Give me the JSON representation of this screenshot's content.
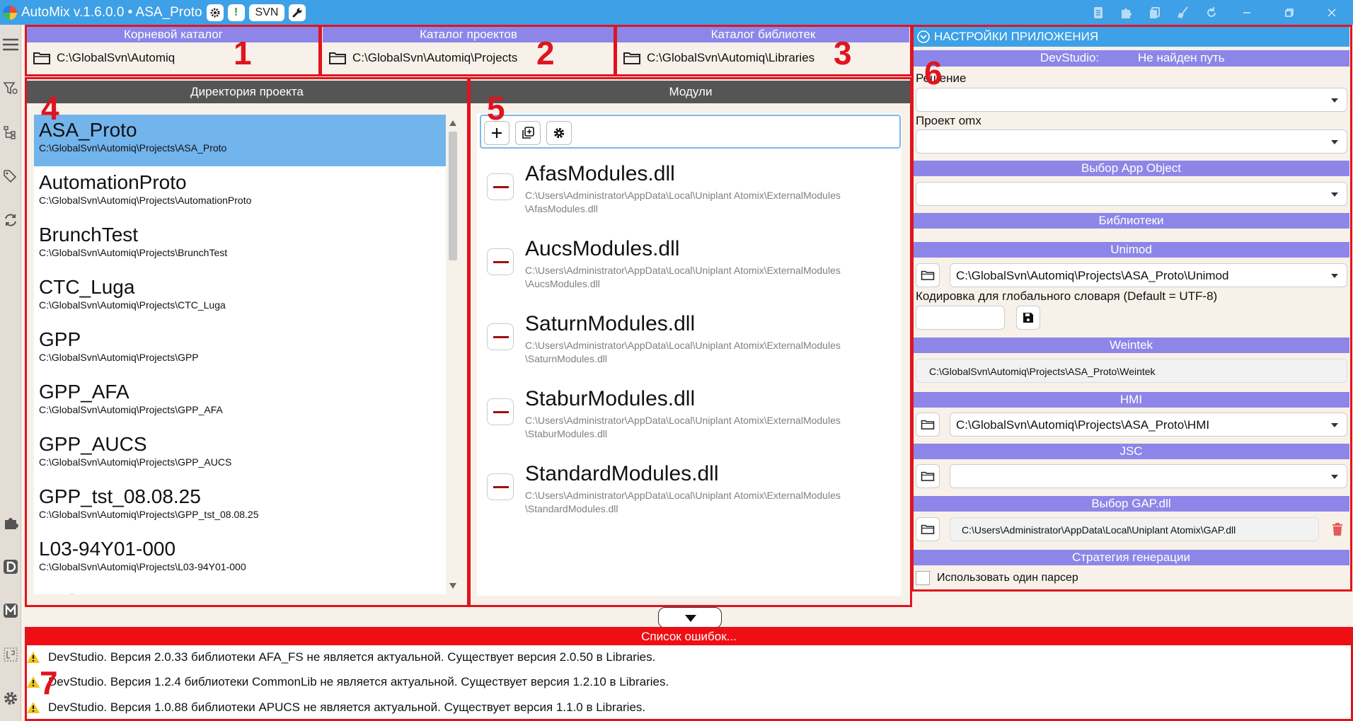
{
  "title_bar": {
    "title": "AutoMix v.1.6.0.0 • ASA_Proto",
    "svn_label": "SVN",
    "alert_label": "!"
  },
  "roots": {
    "root": {
      "header": "Корневой каталог",
      "path": "C:\\GlobalSvn\\Automiq"
    },
    "projects": {
      "header": "Каталог проектов",
      "path": "C:\\GlobalSvn\\Automiq\\Projects"
    },
    "libraries": {
      "header": "Каталог библиотек",
      "path": "C:\\GlobalSvn\\Automiq\\Libraries"
    }
  },
  "project_dir": {
    "header": "Директория проекта",
    "items": [
      {
        "name": "ASA_Proto",
        "path": "C:\\GlobalSvn\\Automiq\\Projects\\ASA_Proto",
        "selected": true
      },
      {
        "name": "AutomationProto",
        "path": "C:\\GlobalSvn\\Automiq\\Projects\\AutomationProto"
      },
      {
        "name": "BrunchTest",
        "path": "C:\\GlobalSvn\\Automiq\\Projects\\BrunchTest"
      },
      {
        "name": "CTC_Luga",
        "path": "C:\\GlobalSvn\\Automiq\\Projects\\CTC_Luga"
      },
      {
        "name": "GPP",
        "path": "C:\\GlobalSvn\\Automiq\\Projects\\GPP"
      },
      {
        "name": "GPP_AFA",
        "path": "C:\\GlobalSvn\\Automiq\\Projects\\GPP_AFA"
      },
      {
        "name": "GPP_AUCS",
        "path": "C:\\GlobalSvn\\Automiq\\Projects\\GPP_AUCS"
      },
      {
        "name": "GPP_tst_08.08.25",
        "path": "C:\\GlobalSvn\\Automiq\\Projects\\GPP_tst_08.08.25"
      },
      {
        "name": "L03-94Y01-000",
        "path": "C:\\GlobalSvn\\Automiq\\Projects\\L03-94Y01-000"
      },
      {
        "name": "LNG",
        "path": ""
      }
    ]
  },
  "modules": {
    "header": "Модули",
    "items": [
      {
        "name": "AfasModules.dll",
        "path": "C:\\Users\\Administrator\\AppData\\Local\\Uniplant Atomix\\ExternalModules\n\\AfasModules.dll"
      },
      {
        "name": "AucsModules.dll",
        "path": "C:\\Users\\Administrator\\AppData\\Local\\Uniplant Atomix\\ExternalModules\n\\AucsModules.dll"
      },
      {
        "name": "SaturnModules.dll",
        "path": "C:\\Users\\Administrator\\AppData\\Local\\Uniplant Atomix\\ExternalModules\n\\SaturnModules.dll"
      },
      {
        "name": "StaburModules.dll",
        "path": "C:\\Users\\Administrator\\AppData\\Local\\Uniplant Atomix\\ExternalModules\n\\StaburModules.dll"
      },
      {
        "name": "StandardModules.dll",
        "path": "C:\\Users\\Administrator\\AppData\\Local\\Uniplant Atomix\\ExternalModules\n\\StandardModules.dll"
      }
    ]
  },
  "settings": {
    "header": "НАСТРОЙКИ ПРИЛОЖЕНИЯ",
    "devstudio_label": "DevStudio:",
    "devstudio_value": "Не найден путь",
    "solution_label": "Решение",
    "project_omx_label": "Проект omx",
    "app_object_header": "Выбор App Object",
    "libraries_header": "Библиотеки",
    "unimod_header": "Unimod",
    "unimod_path": "C:\\GlobalSvn\\Automiq\\Projects\\ASA_Proto\\Unimod",
    "encoding_label": "Кодировка для глобального словаря (Default = UTF-8)",
    "weintek_header": "Weintek",
    "weintek_path": "C:\\GlobalSvn\\Automiq\\Projects\\ASA_Proto\\Weintek",
    "hmi_header": "HMI",
    "hmi_path": "C:\\GlobalSvn\\Automiq\\Projects\\ASA_Proto\\HMI",
    "jsc_header": "JSC",
    "gap_header": "Выбор GAP.dll",
    "gap_path": "C:\\Users\\Administrator\\AppData\\Local\\Uniplant Atomix\\GAP.dll",
    "strategy_header": "Стратегия генерации",
    "single_parser_label": "Использовать один парсер"
  },
  "errors": {
    "header": "Список ошибок...",
    "items": [
      "DevStudio. Версия 2.0.33 библиотеки AFA_FS не является актуальной. Существует версия 2.0.50 в Libraries.",
      "DevStudio. Версия 1.2.4 библиотеки CommonLib не является актуальной. Существует версия 1.2.10 в Libraries.",
      "DevStudio. Версия 1.0.88 библиотеки APUCS не является актуальной. Существует версия 1.1.0 в Libraries."
    ]
  },
  "annotations": [
    "1",
    "2",
    "3",
    "4",
    "5",
    "6",
    "7"
  ],
  "colors": {
    "accent": "#3ea0e6",
    "header_purple": "#8d86e8",
    "highlight_red": "#e0141e",
    "error_red": "#f00e12",
    "selection": "#72b4ec"
  }
}
